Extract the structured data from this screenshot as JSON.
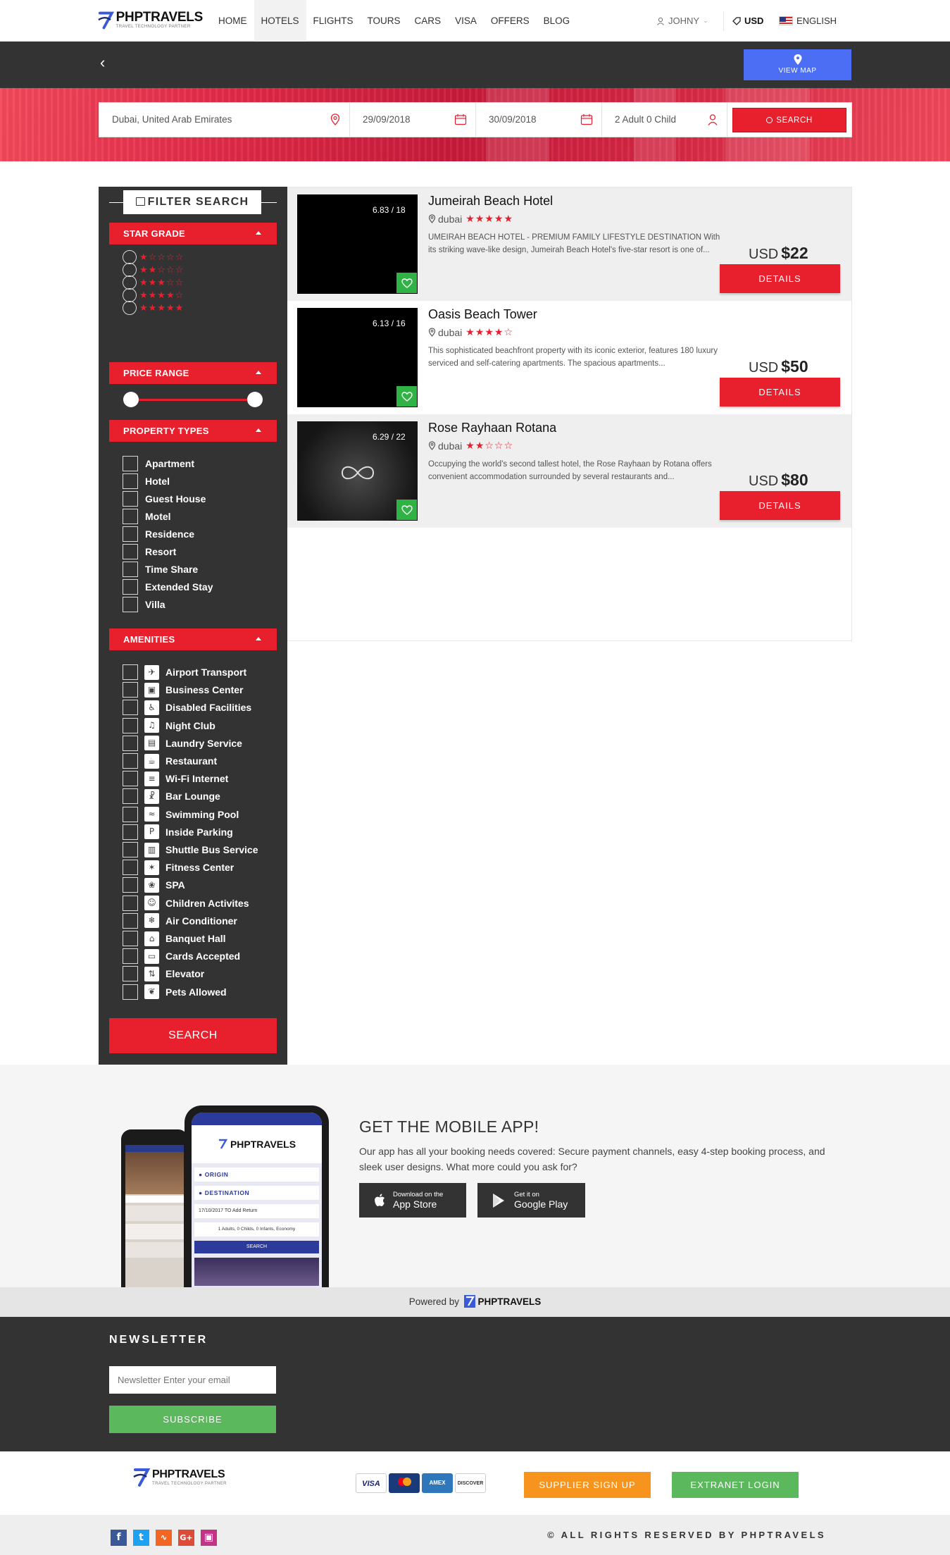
{
  "header": {
    "logo_title": "PHPTRAVELS",
    "logo_subtitle": "TRAVEL TECHNOLOGY PARTNER",
    "nav": [
      "HOME",
      "HOTELS",
      "FLIGHTS",
      "TOURS",
      "CARS",
      "VISA",
      "OFFERS",
      "BLOG"
    ],
    "active_nav": "HOTELS",
    "user": "JOHNY",
    "currency": "USD",
    "language": "ENGLISH"
  },
  "toolbar": {
    "view_map": "VIEW MAP"
  },
  "search": {
    "destination": "Dubai, United Arab Emirates",
    "checkin": "29/09/2018",
    "checkout": "30/09/2018",
    "guests": "2 Adult 0 Child",
    "button": "SEARCH"
  },
  "filter": {
    "title": "FILTER SEARCH",
    "star_grade_label": "STAR GRADE",
    "star_options": [
      "★☆☆☆☆",
      "★★☆☆☆",
      "★★★☆☆",
      "★★★★☆",
      "★★★★★"
    ],
    "price_range_label": "PRICE RANGE",
    "property_types_label": "PROPERTY TYPES",
    "property_types": [
      "Apartment",
      "Hotel",
      "Guest House",
      "Motel",
      "Residence",
      "Resort",
      "Time Share",
      "Extended Stay",
      "Villa"
    ],
    "amenities_label": "AMENITIES",
    "amenities": [
      {
        "label": "Airport Transport",
        "icon": "airplane-icon"
      },
      {
        "label": "Business Center",
        "icon": "briefcase-icon"
      },
      {
        "label": "Disabled Facilities",
        "icon": "wheelchair-icon"
      },
      {
        "label": "Night Club",
        "icon": "music-icon"
      },
      {
        "label": "Laundry Service",
        "icon": "laundry-icon"
      },
      {
        "label": "Restaurant",
        "icon": "food-icon"
      },
      {
        "label": "Wi-Fi Internet",
        "icon": "wifi-icon"
      },
      {
        "label": "Bar Lounge",
        "icon": "cocktail-icon"
      },
      {
        "label": "Swimming Pool",
        "icon": "pool-icon"
      },
      {
        "label": "Inside Parking",
        "icon": "parking-icon"
      },
      {
        "label": "Shuttle Bus Service",
        "icon": "bus-icon"
      },
      {
        "label": "Fitness Center",
        "icon": "fitness-icon"
      },
      {
        "label": "SPA",
        "icon": "spa-icon"
      },
      {
        "label": "Children Activites",
        "icon": "children-icon"
      },
      {
        "label": "Air Conditioner",
        "icon": "air-conditioner-icon"
      },
      {
        "label": "Banquet Hall",
        "icon": "banquet-icon"
      },
      {
        "label": "Cards Accepted",
        "icon": "card-icon"
      },
      {
        "label": "Elevator",
        "icon": "elevator-icon"
      },
      {
        "label": "Pets Allowed",
        "icon": "pet-icon"
      }
    ],
    "search_button": "SEARCH"
  },
  "hotels": [
    {
      "name": "Jumeirah Beach Hotel",
      "location": "dubai",
      "stars": "★★★★★",
      "gallery_count": "6.83 / 18",
      "description": "UMEIRAH BEACH HOTEL - PREMIUM FAMILY LIFESTYLE DESTINATION With its striking wave-like design, Jumeirah Beach Hotel's five-star resort is one of...",
      "currency": "USD",
      "price": "$22",
      "button": "DETAILS"
    },
    {
      "name": "Oasis Beach Tower",
      "location": "dubai",
      "stars": "★★★★☆",
      "gallery_count": "6.13 / 16",
      "description": "This sophisticated beachfront property with its iconic exterior, features 180 luxury serviced and self-catering apartments. The spacious apartments...",
      "currency": "USD",
      "price": "$50",
      "button": "DETAILS"
    },
    {
      "name": "Rose Rayhaan Rotana",
      "location": "dubai",
      "stars": "★★☆☆☆",
      "gallery_count": "6.29 / 22",
      "description": "Occupying the world's second tallest hotel, the Rose Rayhaan by Rotana offers convenient accommodation surrounded by several restaurants and...",
      "currency": "USD",
      "price": "$80",
      "button": "DETAILS"
    }
  ],
  "app": {
    "title": "GET THE MOBILE APP!",
    "description": "Our app has all your booking needs covered: Secure payment channels, easy 4-step booking process, and sleek user designs. What more could you ask for?",
    "appstore_small": "Download on the",
    "appstore_big": "App Store",
    "googleplay_small": "Get it on",
    "googleplay_big": "Google Play",
    "phone_origin": "ORIGIN",
    "phone_destination": "DESTINATION",
    "phone_date": "17/10/2017  TO  Add Return",
    "phone_pax": "1 Adults, 0 Childs, 0 Infants, Economy",
    "phone_search": "SEARCH"
  },
  "powered": {
    "label": "Powered by",
    "brand": "PHPTRAVELS"
  },
  "newsletter": {
    "title": "NEWSLETTER",
    "placeholder": "Newsletter Enter your email",
    "button": "SUBSCRIBE"
  },
  "footer": {
    "cards": [
      "VISA",
      "MasterCard",
      "AMEX",
      "DISCOVER"
    ],
    "supplier_signup": "SUPPLIER SIGN UP",
    "extranet_login": "EXTRANET LOGIN",
    "copyright": "© ALL RIGHTS RESERVED BY PHPTRAVELS",
    "social": [
      "facebook-icon",
      "twitter-icon",
      "rss-icon",
      "google-plus-icon",
      "instagram-icon"
    ]
  },
  "colors": {
    "accent": "#e8202e",
    "dark": "#333333",
    "map_button": "#4c6ef5",
    "success": "#5cb85c",
    "orange": "#f7941d"
  }
}
